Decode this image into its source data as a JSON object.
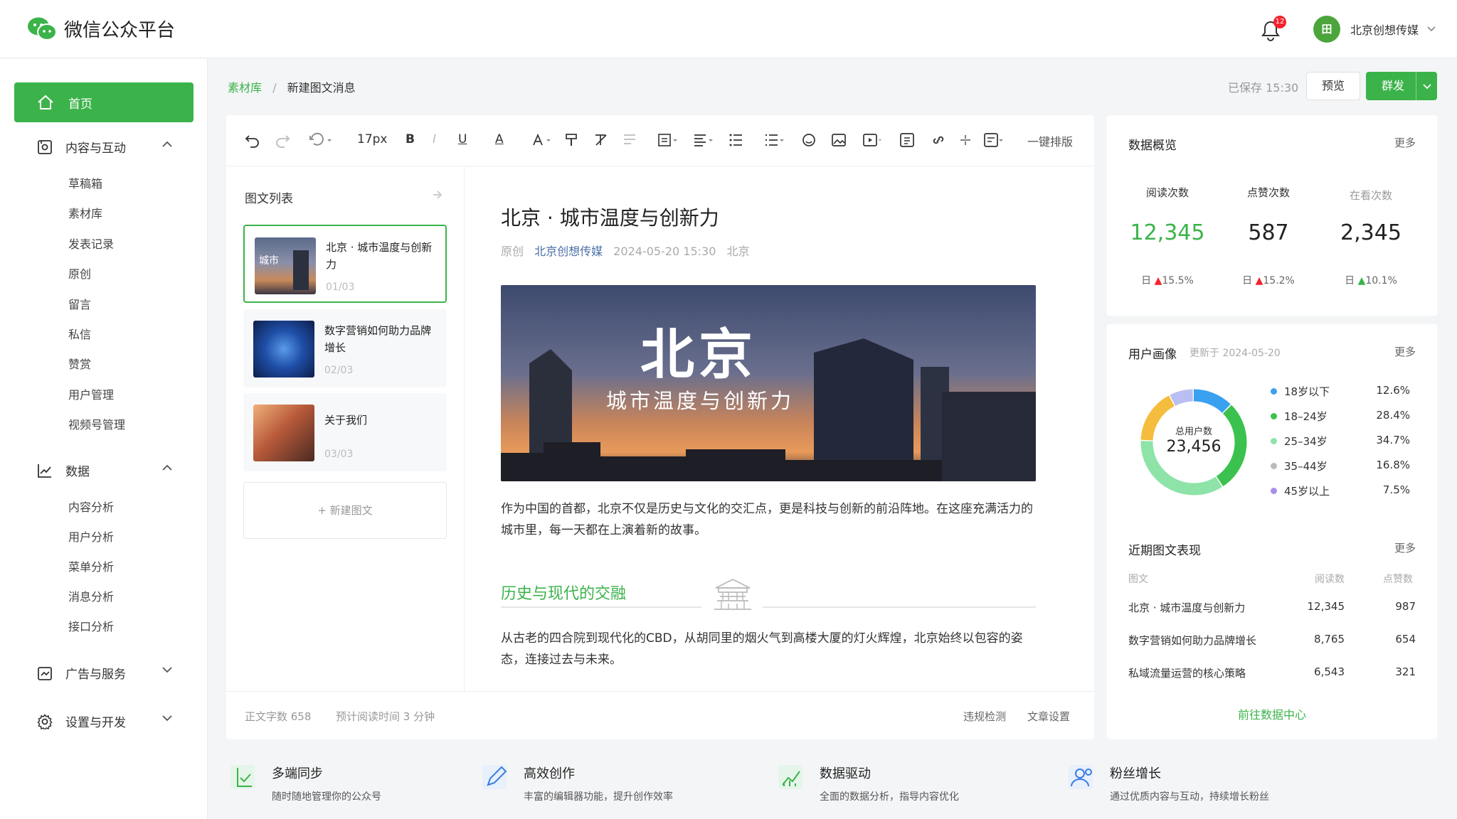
{
  "app": {
    "title": "微信公众平台",
    "notifications": "12",
    "account": "北京创想传媒",
    "avatar_text": "田"
  },
  "sidebar": {
    "home": "首页",
    "groups": [
      {
        "label": "内容与互动",
        "items": [
          "草稿箱",
          "素材库",
          "发表记录",
          "原创",
          "留言",
          "私信",
          "赞赏",
          "用户管理",
          "视频号管理"
        ]
      },
      {
        "label": "数据",
        "items": [
          "内容分析",
          "用户分析",
          "菜单分析",
          "消息分析",
          "接口分析"
        ]
      },
      {
        "label": "广告与服务"
      },
      {
        "label": "设置与开发"
      }
    ]
  },
  "breadcrumb": {
    "root": "素材库",
    "sep": "/",
    "current": "新建图文消息"
  },
  "header": {
    "saved": "已保存 15:30",
    "preview": "预览",
    "send": "群发"
  },
  "toolbar": {
    "font_size": "17px",
    "bold": "B",
    "italic": "I",
    "underline": "U",
    "color": "A",
    "auto_format": "一键排版"
  },
  "list": {
    "title": "图文列表",
    "cards": [
      {
        "title": "北京 · 城市温度与创新力",
        "index": "01/03",
        "thumb_text": "城市"
      },
      {
        "title": "数字营销如何助力品牌增长",
        "index": "02/03"
      },
      {
        "title": "关于我们",
        "index": "03/03"
      }
    ],
    "new": "+ 新建图文"
  },
  "article": {
    "title": "北京 · 城市温度与创新力",
    "meta": {
      "original": "原创",
      "author": "北京创想传媒",
      "date": "2024-05-20 15:30",
      "location": "北京"
    },
    "hero_title": "北京",
    "hero_subtitle": "城市温度与创新力",
    "para1": "作为中国的首都，北京不仅是历史与文化的交汇点，更是科技与创新的前沿阵地。在这座充满活力的城市里，每一天都在上演着新的故事。",
    "h2": "历史与现代的交融",
    "para2": "从古老的四合院到现代化的CBD，从胡同里的烟火气到高楼大厦的灯火辉煌，北京始终以包容的姿态，连接过去与未来。"
  },
  "editor_footer": {
    "word_count": "正文字数 658",
    "read_time": "预计阅读时间 3 分钟",
    "check": "违规检测",
    "settings": "文章设置"
  },
  "overview": {
    "title": "数据概览",
    "more": "更多",
    "kpis": [
      {
        "label": "阅读次数",
        "value": "12,345",
        "day": "日",
        "delta": "15.5%",
        "trend": "up-red",
        "color": "#3bb34a"
      },
      {
        "label": "点赞次数",
        "value": "587",
        "day": "日",
        "delta": "15.2%",
        "trend": "up-red",
        "color": "#222222"
      },
      {
        "label": "在看次数",
        "value": "2,345",
        "day": "日",
        "delta": "10.1%",
        "trend": "up-green",
        "color": "#222222"
      }
    ]
  },
  "portrait": {
    "title": "用户画像",
    "updated": "更新于 2024-05-20",
    "more": "更多",
    "total_label": "总用户数",
    "total": "23,456",
    "segments": [
      {
        "label": "18岁以下",
        "value": "12.6%",
        "pct": 12.6,
        "color": "#3aa0f0"
      },
      {
        "label": "18–24岁",
        "value": "28.4%",
        "pct": 28.4,
        "color": "#3bc24e"
      },
      {
        "label": "25–34岁",
        "value": "34.7%",
        "pct": 34.7,
        "color": "#8ee3a8"
      },
      {
        "label": "35–44岁",
        "value": "16.8%",
        "pct": 16.8,
        "color": "#f5bd3d"
      },
      {
        "label": "45岁以上",
        "value": "7.5%",
        "pct": 7.5,
        "color": "#b9bff2"
      }
    ]
  },
  "recent": {
    "title": "近期图文表现",
    "more": "更多",
    "headers": [
      "图文",
      "阅读数",
      "点赞数"
    ],
    "rows": [
      {
        "title": "北京 · 城市温度与创新力",
        "reads": "12,345",
        "likes": "987"
      },
      {
        "title": "数字营销如何助力品牌增长",
        "reads": "8,765",
        "likes": "654"
      },
      {
        "title": "私域流量运营的核心策略",
        "reads": "6,543",
        "likes": "321"
      }
    ],
    "link": "前往数据中心"
  },
  "features": [
    {
      "title": "多端同步",
      "desc": "随时随地管理你的公众号"
    },
    {
      "title": "高效创作",
      "desc": "丰富的编辑器功能，提升创作效率"
    },
    {
      "title": "数据驱动",
      "desc": "全面的数据分析，指导内容优化"
    },
    {
      "title": "粉丝增长",
      "desc": "通过优质内容与互动，持续增长粉丝"
    }
  ]
}
